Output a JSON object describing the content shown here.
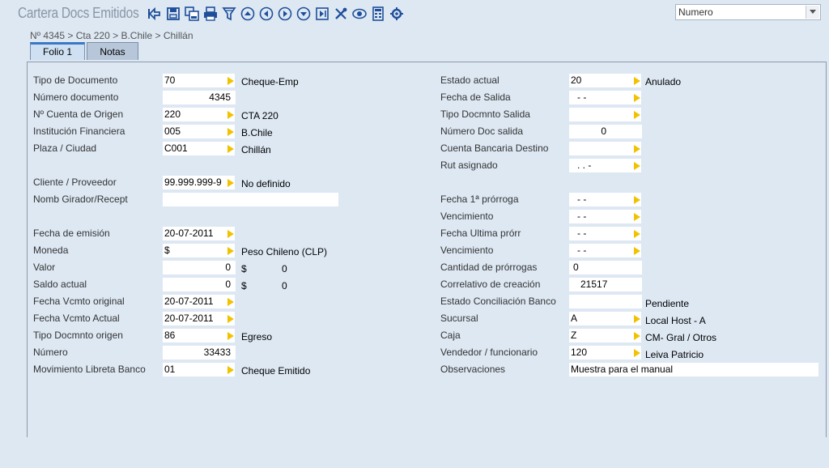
{
  "app": {
    "title": "Cartera Docs Emitidos",
    "search_select": "Numero"
  },
  "toolbar": {
    "buttons": [
      "back-icon",
      "save-icon",
      "save-copy-icon",
      "print-icon",
      "filter-icon",
      "first-record-icon",
      "previous-record-icon",
      "next-record-icon",
      "last-record-icon",
      "jump-icon",
      "tools-icon",
      "view-icon",
      "calculator-icon",
      "settings-icon"
    ]
  },
  "breadcrumb": "Nº 4345 > Cta 220 > B.Chile > Chillán",
  "tabs": [
    {
      "label": "Folio 1",
      "active": true
    },
    {
      "label": "Notas",
      "active": false
    }
  ],
  "left": {
    "tipo_documento": {
      "label": "Tipo de Documento",
      "value": "70",
      "desc": "Cheque-Emp"
    },
    "numero_documento": {
      "label": "Número documento",
      "value": "4345"
    },
    "cuenta_origen": {
      "label": "Nº Cuenta de Origen",
      "value": "220",
      "desc": "CTA 220"
    },
    "institucion": {
      "label": "Institución Financiera",
      "value": "005",
      "desc": "B.Chile"
    },
    "plaza": {
      "label": "Plaza / Ciudad",
      "value": "C001",
      "desc": "Chillán"
    },
    "cliente": {
      "label": "Cliente / Proveedor",
      "value": "99.999.999-9",
      "desc": "No definido"
    },
    "girador": {
      "label": "Nomb Girador/Recept",
      "value": ""
    },
    "fecha_emision": {
      "label": "Fecha de emisión",
      "value": "20-07-2011"
    },
    "moneda": {
      "label": "Moneda",
      "value": "$",
      "desc": "Peso Chileno (CLP)"
    },
    "valor": {
      "label": "Valor",
      "value": "0",
      "currency": "$",
      "amount": "0"
    },
    "saldo": {
      "label": "Saldo actual",
      "value": "0",
      "currency": "$",
      "amount": "0"
    },
    "vcmto_original": {
      "label": "Fecha Vcmto original",
      "value": "20-07-2011"
    },
    "vcmto_actual": {
      "label": "Fecha Vcmto Actual",
      "value": "20-07-2011"
    },
    "tipo_origen": {
      "label": "Tipo Docmnto origen",
      "value": "86",
      "desc": "Egreso"
    },
    "numero": {
      "label": "Número",
      "value": "33433"
    },
    "movimiento": {
      "label": "Movimiento Libreta Banco",
      "value": "01",
      "desc": "Cheque Emitido"
    }
  },
  "right": {
    "estado_actual": {
      "label": "Estado actual",
      "value": "20",
      "desc": "Anulado"
    },
    "fecha_salida": {
      "label": "Fecha de Salida",
      "value": "-  -"
    },
    "tipo_salida": {
      "label": "Tipo Docmnto Salida",
      "value": ""
    },
    "numero_salida": {
      "label": "Número Doc salida",
      "value": "0"
    },
    "cuenta_destino": {
      "label": "Cuenta Bancaria Destino",
      "value": ""
    },
    "rut": {
      "label": "Rut asignado",
      "value": ".   .   -"
    },
    "prorroga1": {
      "label": "Fecha 1ª prórroga",
      "value": "-  -"
    },
    "vencimiento1": {
      "label": "Vencimiento",
      "value": "-  -"
    },
    "ultima_prorr": {
      "label": "Fecha Ultima prórr",
      "value": "-  -"
    },
    "vencimiento2": {
      "label": "Vencimiento",
      "value": "-  -"
    },
    "cantidad": {
      "label": "Cantidad de prórrogas",
      "value": "0"
    },
    "correlativo": {
      "label": "Correlativo de creación",
      "value": "21517"
    },
    "conciliacion": {
      "label": "Estado Conciliación Banco",
      "value": "",
      "desc": "Pendiente"
    },
    "sucursal": {
      "label": "Sucursal",
      "value": "A",
      "desc": "Local Host - A"
    },
    "caja": {
      "label": "Caja",
      "value": "Z",
      "desc": "CM- Gral / Otros"
    },
    "vendedor": {
      "label": "Vendedor / funcionario",
      "value": "120",
      "desc": "Leiva Patricio"
    },
    "observaciones": {
      "label": "Observaciones",
      "value": "Muestra para el manual"
    }
  },
  "colors": {
    "lookup_arrow": "#f2c200",
    "toolbar_icon": "#1f4f9a",
    "background": "#dde8f3"
  }
}
